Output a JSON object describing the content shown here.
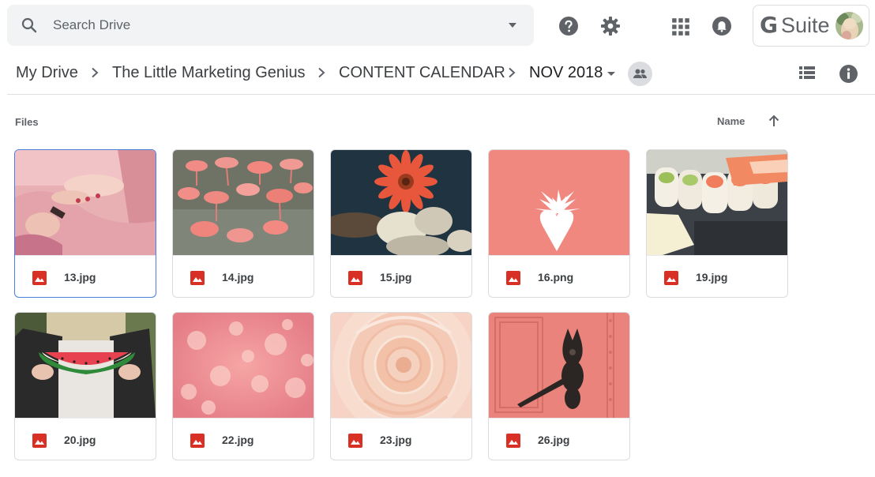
{
  "search": {
    "placeholder": "Search Drive"
  },
  "header": {
    "brand": {
      "g": "G",
      "word": "Suite"
    },
    "icons": [
      "help-icon",
      "settings-icon",
      "apps-grid-icon",
      "notifications-icon"
    ]
  },
  "breadcrumb": {
    "items": [
      "My Drive",
      "The Little Marketing Genius",
      "CONTENT CALENDAR",
      "NOV 2018"
    ]
  },
  "files": {
    "section_label": "Files",
    "sort_label": "Name",
    "items": [
      {
        "name": "13.jpg",
        "selected": true
      },
      {
        "name": "14.jpg"
      },
      {
        "name": "15.jpg"
      },
      {
        "name": "16.png"
      },
      {
        "name": "19.jpg"
      },
      {
        "name": "20.jpg"
      },
      {
        "name": "22.jpg"
      },
      {
        "name": "23.jpg"
      },
      {
        "name": "26.jpg"
      }
    ]
  },
  "colors": {
    "accent": "#4a7fd8",
    "file_icon": "#d93025",
    "coral": "#f28b82"
  }
}
